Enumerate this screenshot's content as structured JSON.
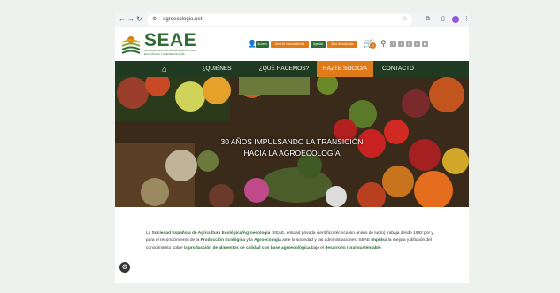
{
  "browser": {
    "url": "agroecologia.net",
    "back_icon": "back-arrow-icon",
    "forward_icon": "forward-arrow-icon",
    "reload_icon": "reload-icon"
  },
  "site": {
    "logo_text": "SEAE",
    "logo_sub": "SOCIEDAD ESPAÑOLA DE AGRICULTURA ECOLÓGICA Y AGROECOLOGÍA",
    "top_buttons": [
      "Acceso",
      "Área de mercadotecnia",
      "Agenda",
      "Área de socios/as"
    ],
    "cart_count": "0"
  },
  "nav": {
    "items": [
      "¿QUIÉNES SOMOS?",
      "¿QUÉ HACEMOS?",
      "HAZTE SOCIO/A",
      "CONTACTO"
    ]
  },
  "hero": {
    "line1": "30 AÑOS IMPULSANDO LA TRANSICIÓN",
    "line2": "HACIA LA AGROECOLOGÍA"
  },
  "intro": {
    "p1": "La ",
    "b1": "Sociedad Española de Agricultura Ecológica/Agroecología",
    "p2": " (SEAE, entidad privada científico-técnica sin ánimo de lucro) trabaja desde 1992 por y para el reconocimiento de la ",
    "b2": "Producción Ecológica",
    "p3": " y la ",
    "b3": "Agroecología",
    "p4": " ante la sociedad y las administraciones. SEAE ",
    "b4": "impulsa",
    "p5": " la mejora y difusión del conocimiento sobre la ",
    "b5": "producción de alimentos de calidad con base agroecológica",
    "p6": " bajo el ",
    "b6": "desarrollo rural sustentable",
    "p7": "."
  },
  "colors": {
    "brand_green": "#2f6b35",
    "nav_bg": "#203a22",
    "accent_orange": "#e07b1a"
  }
}
